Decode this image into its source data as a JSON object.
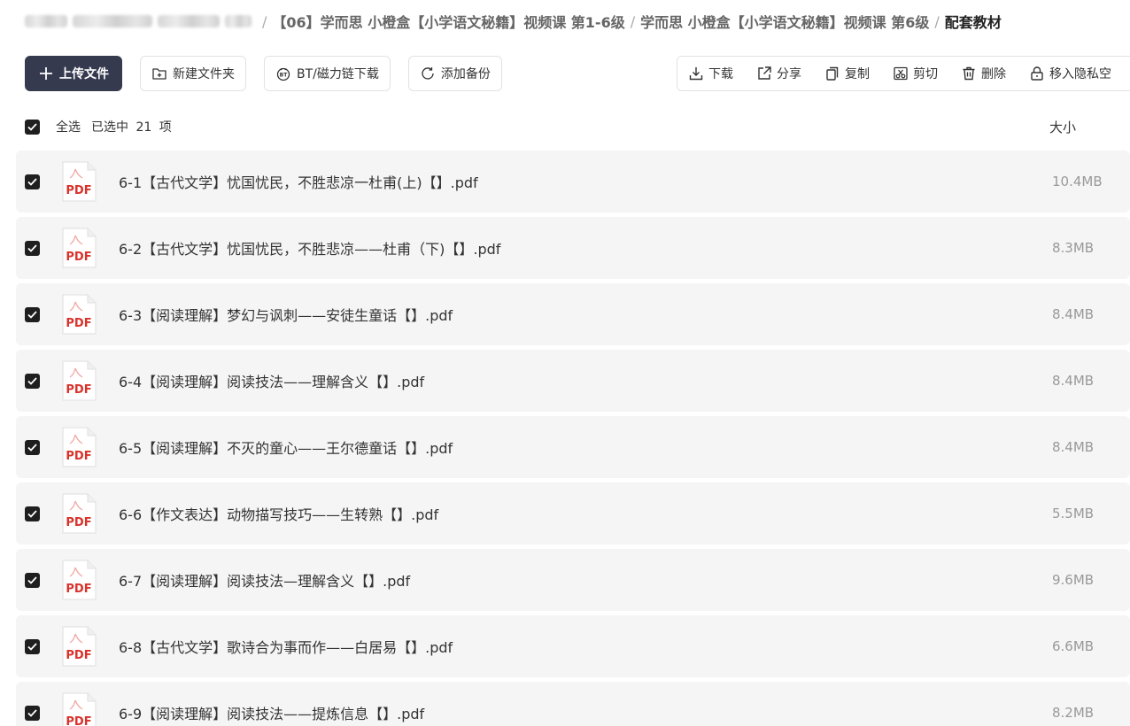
{
  "breadcrumb": {
    "items": [
      "【06】学而思 小橙盒【小学语文秘籍】视频课 第1-6级",
      "学而思 小橙盒【小学语文秘籍】视频课 第6级"
    ],
    "current": "配套教材",
    "separator": "/"
  },
  "toolbar": {
    "upload_label": "上传文件",
    "new_folder_label": "新建文件夹",
    "bt_download_label": "BT/磁力链下载",
    "add_backup_label": "添加备份"
  },
  "actions": {
    "download_label": "下载",
    "share_label": "分享",
    "copy_label": "复制",
    "cut_label": "剪切",
    "delete_label": "删除",
    "move_private_label": "移入隐私空"
  },
  "list_header": {
    "select_all_label": "全选",
    "selected_info": "已选中 21 项",
    "size_column": "大小"
  },
  "file_icon_text": "PDF",
  "files": [
    {
      "name": "6-1【古代文学】忧国忧民，不胜悲凉一杜甫(上)【】.pdf",
      "size": "10.4MB"
    },
    {
      "name": "6-2【古代文学】忧国忧民，不胜悲凉——杜甫（下)【】.pdf",
      "size": "8.3MB"
    },
    {
      "name": "6-3【阅读理解】梦幻与讽刺——安徒生童话【】.pdf",
      "size": "8.4MB"
    },
    {
      "name": "6-4【阅读理解】阅读技法——理解含义【】.pdf",
      "size": "8.4MB"
    },
    {
      "name": "6-5【阅读理解】不灭的童心——王尔德童话【】.pdf",
      "size": "8.4MB"
    },
    {
      "name": "6-6【作文表达】动物描写技巧——生转熟【】.pdf",
      "size": "5.5MB"
    },
    {
      "name": "6-7【阅读理解】阅读技法—理解含义【】.pdf",
      "size": "9.6MB"
    },
    {
      "name": "6-8【古代文学】歌诗合为事而作——白居易【】.pdf",
      "size": "6.6MB"
    },
    {
      "name": "6-9【阅读理解】阅读技法——提炼信息【】.pdf",
      "size": "8.2MB"
    }
  ],
  "colors": {
    "primary_button": "#363a4f",
    "pdf_red": "#d9322b",
    "row_bg": "#f5f5f6"
  }
}
